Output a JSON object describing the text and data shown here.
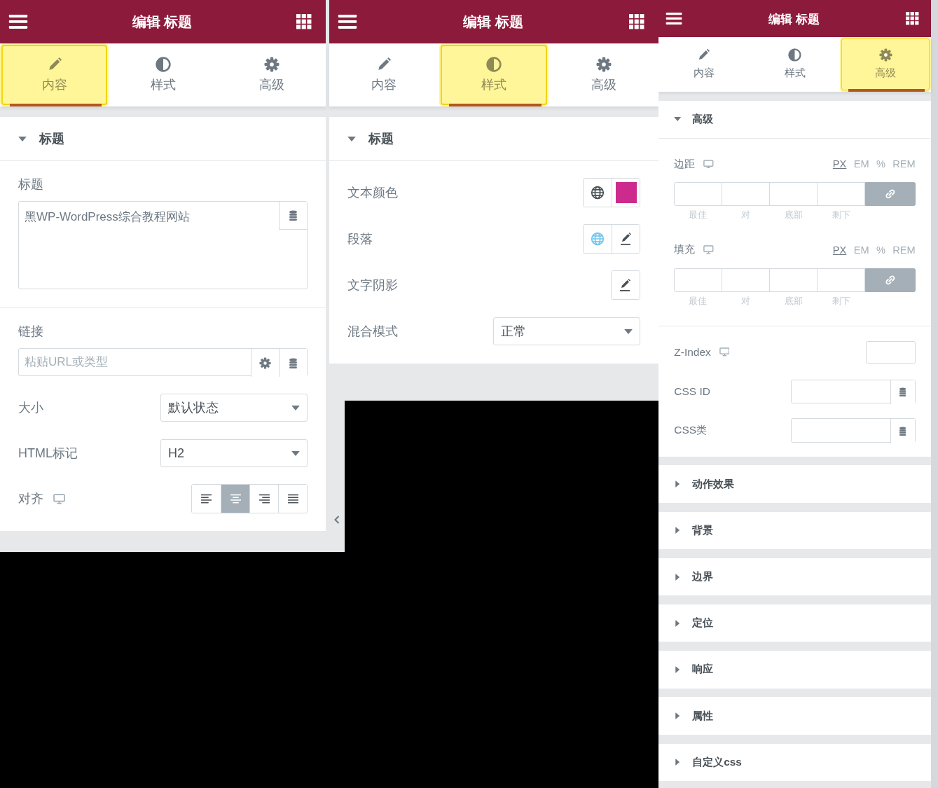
{
  "panels": [
    {
      "title": "编辑 标题",
      "tabs": [
        {
          "label": "内容",
          "selected": true
        },
        {
          "label": "样式",
          "selected": false
        },
        {
          "label": "高级",
          "selected": false
        }
      ],
      "sections": [
        {
          "title": "标题",
          "expanded": true,
          "groups": [
            {
              "controls": [
                {
                  "kind": "textarea",
                  "label": "标题",
                  "value": "黑WP-WordPress综合教程网站"
                }
              ]
            },
            {
              "controls": [
                {
                  "kind": "url",
                  "label": "链接",
                  "placeholder": "粘贴URL或类型"
                },
                {
                  "kind": "select",
                  "label": "大小",
                  "value": "默认状态"
                },
                {
                  "kind": "select",
                  "label": "HTML标记",
                  "value": "H2"
                },
                {
                  "kind": "align",
                  "label": "对齐",
                  "responsive": true,
                  "options": [
                    {
                      "selected": false
                    },
                    {
                      "selected": true
                    },
                    {
                      "selected": false
                    },
                    {
                      "selected": false
                    }
                  ]
                }
              ]
            }
          ]
        }
      ]
    },
    {
      "title": "编辑 标题",
      "tabs": [
        {
          "label": "内容",
          "selected": false
        },
        {
          "label": "样式",
          "selected": true
        },
        {
          "label": "高级",
          "selected": false
        }
      ],
      "sections": [
        {
          "title": "标题",
          "expanded": true,
          "groups": [
            {
              "controls": [
                {
                  "kind": "color",
                  "label": "文本颜色",
                  "color": "#cc2a8c"
                },
                {
                  "kind": "typography",
                  "label": "段落",
                  "global_active": true
                },
                {
                  "kind": "shadow",
                  "label": "文字阴影"
                },
                {
                  "kind": "select",
                  "label": "混合模式",
                  "value": "正常"
                }
              ]
            }
          ]
        }
      ]
    },
    {
      "title": "编辑 标题",
      "tabs": [
        {
          "label": "内容",
          "selected": false
        },
        {
          "label": "样式",
          "selected": false
        },
        {
          "label": "高级",
          "selected": true
        }
      ],
      "sections": [
        {
          "title": "高级",
          "expanded": true,
          "groups": [
            {
              "controls": [
                {
                  "kind": "dimensions",
                  "label": "边距",
                  "responsive": true,
                  "units": [
                    {
                      "label": "PX",
                      "selected": true
                    },
                    {
                      "label": "EM",
                      "selected": false
                    },
                    {
                      "label": "%",
                      "selected": false
                    },
                    {
                      "label": "REM",
                      "selected": false
                    }
                  ],
                  "sides": [
                    "最佳",
                    "对",
                    "底部",
                    "剩下"
                  ],
                  "linked": true
                },
                {
                  "kind": "dimensions",
                  "label": "填充",
                  "responsive": true,
                  "units": [
                    {
                      "label": "PX",
                      "selected": true
                    },
                    {
                      "label": "EM",
                      "selected": false
                    },
                    {
                      "label": "%",
                      "selected": false
                    },
                    {
                      "label": "REM",
                      "selected": false
                    }
                  ],
                  "sides": [
                    "最佳",
                    "对",
                    "底部",
                    "剩下"
                  ],
                  "linked": true
                }
              ]
            },
            {
              "controls": [
                {
                  "kind": "number",
                  "label": "Z-Index",
                  "responsive": true
                },
                {
                  "kind": "dynamic",
                  "label": "CSS ID"
                },
                {
                  "kind": "dynamic",
                  "label": "CSS类"
                }
              ]
            }
          ]
        },
        {
          "title": "动作效果",
          "expanded": false
        },
        {
          "title": "背景",
          "expanded": false
        },
        {
          "title": "边界",
          "expanded": false
        },
        {
          "title": "定位",
          "expanded": false
        },
        {
          "title": "响应",
          "expanded": false
        },
        {
          "title": "属性",
          "expanded": false
        },
        {
          "title": "自定义css",
          "expanded": false
        }
      ]
    }
  ]
}
